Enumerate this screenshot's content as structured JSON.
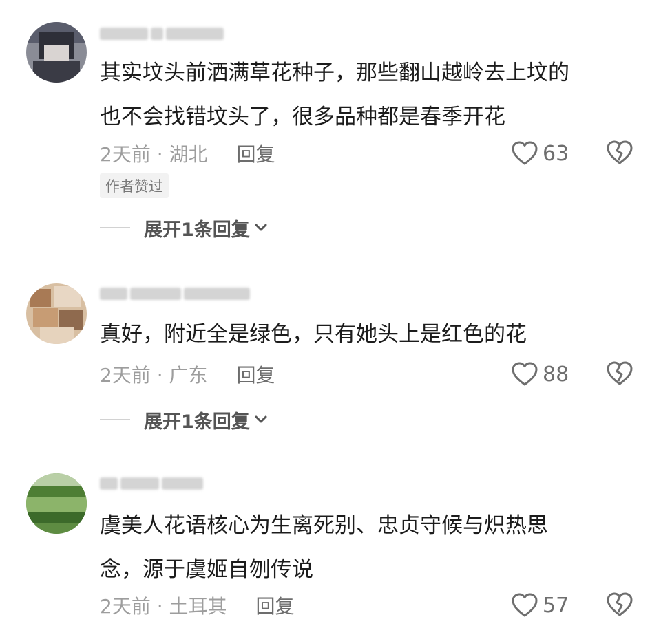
{
  "comments": [
    {
      "text": "其实坟头前洒满草花种子，那些翻山越岭去上坟的\n也不会找错坟头了，很多品种都是春季开花",
      "time_location": "2天前 · 湖北",
      "reply_label": "回复",
      "likes": "63",
      "badge": "作者赞过",
      "expand_label": "展开1条回复"
    },
    {
      "text": "真好，附近全是绿色，只有她头上是红色的花",
      "time_location": "2天前 · 广东",
      "reply_label": "回复",
      "likes": "88",
      "expand_label": "展开1条回复"
    },
    {
      "text": "虞美人花语核心为生离死别、忠贞守候与炽热思\n念，源于虞姬自刎传说",
      "time_location": "2天前 · 土耳其",
      "reply_label": "回复",
      "likes": "57"
    }
  ],
  "icons": {
    "like": "heart-outline-icon",
    "dislike": "broken-heart-icon",
    "expand": "chevron-down-icon"
  },
  "colors": {
    "text": "#1c1c1c",
    "meta": "#9d9d9d",
    "icon": "#6e6e6e"
  }
}
